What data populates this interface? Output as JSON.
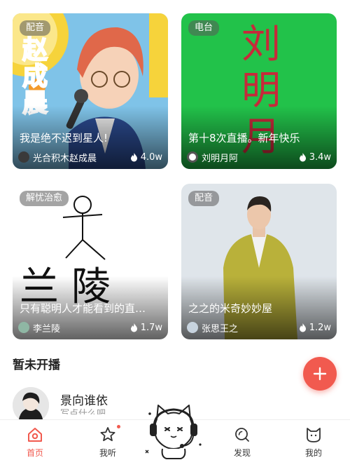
{
  "cards": [
    {
      "badge": "配音",
      "title": "我是绝不迟到星人!",
      "author": "光合积木赵成晨",
      "heat": "4.0w",
      "art_text": "赵成晨",
      "colors": {
        "bg": "#7fc3e8",
        "accent": "#f6d33b",
        "hair": "#e0684a"
      }
    },
    {
      "badge": "电台",
      "title": "第十8次直播。新年快乐",
      "author": "刘明月阿",
      "heat": "3.4w",
      "art_text": "刘明月",
      "colors": {
        "bg": "#22c24a",
        "ink": "#c62a3a"
      }
    },
    {
      "badge": "解忧治愈",
      "title": "只有聪明人才能看到的直…",
      "author": "李兰陵",
      "heat": "1.7w",
      "art_text": "兰陵",
      "colors": {
        "bg": "#ffffff",
        "ink": "#111111"
      }
    },
    {
      "badge": "配音",
      "title": "之之的米奇妙妙屋",
      "author": "张思王之",
      "heat": "1.2w",
      "colors": {
        "bg": "#dfe5ea",
        "suit": "#b9b13a"
      }
    }
  ],
  "section": {
    "title": "暂未开播"
  },
  "room": {
    "name": "景向谁依",
    "subtitle": "写点什么吧"
  },
  "tabs": [
    {
      "label": "首页",
      "icon": "home-icon",
      "active": true
    },
    {
      "label": "我听",
      "icon": "star-icon",
      "active": false
    },
    {
      "label": "",
      "icon": "mascot-cat-icon",
      "active": false
    },
    {
      "label": "发现",
      "icon": "discover-icon",
      "active": false
    },
    {
      "label": "我的",
      "icon": "profile-cat-icon",
      "active": false
    }
  ],
  "theme": {
    "accent": "#f15a4f"
  }
}
